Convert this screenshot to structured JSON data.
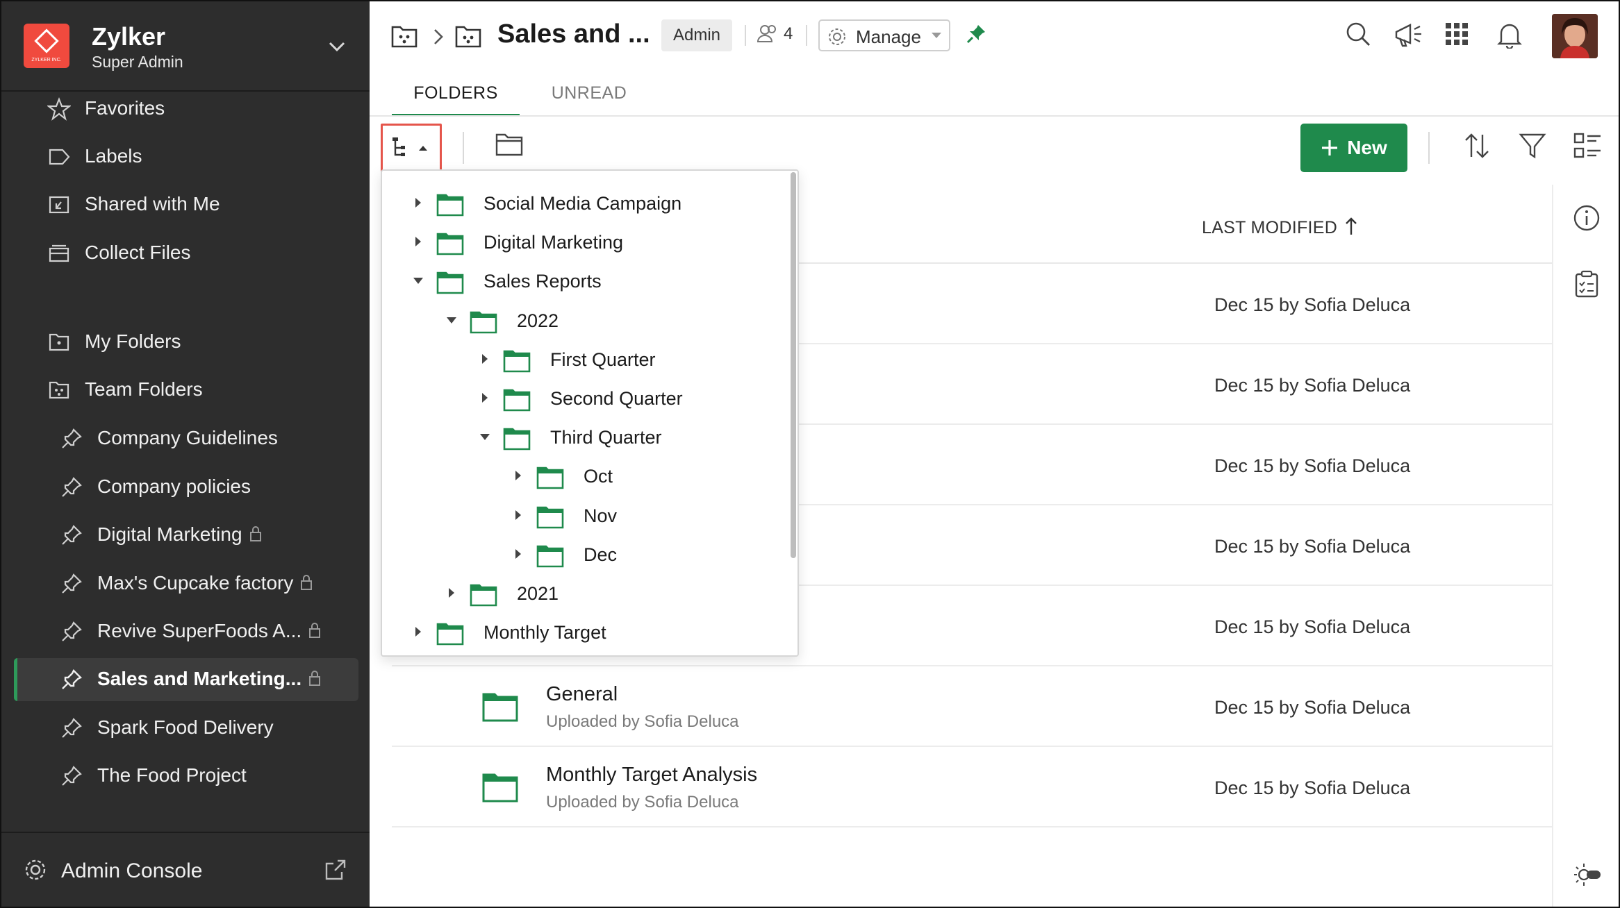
{
  "org": {
    "name": "Zylker",
    "role": "Super Admin",
    "logo_text": "ZYLKER INC."
  },
  "sidebar": {
    "top_items": [
      {
        "label": "Favorites",
        "icon": "star-icon"
      },
      {
        "label": "Labels",
        "icon": "label-icon"
      },
      {
        "label": "Shared with Me",
        "icon": "shared-icon"
      },
      {
        "label": "Collect Files",
        "icon": "collect-icon"
      }
    ],
    "folder_items": [
      {
        "label": "My Folders",
        "icon": "my-folders-icon"
      },
      {
        "label": "Team Folders",
        "icon": "team-folders-icon"
      }
    ],
    "team_folders": [
      {
        "label": "Company Guidelines",
        "locked": false,
        "active": false
      },
      {
        "label": "Company policies",
        "locked": false,
        "active": false
      },
      {
        "label": "Digital Marketing",
        "locked": true,
        "active": false
      },
      {
        "label": "Max's Cupcake factory",
        "locked": true,
        "active": false
      },
      {
        "label": "Revive SuperFoods A...",
        "locked": true,
        "active": false
      },
      {
        "label": "Sales and Marketing...",
        "locked": true,
        "active": true
      },
      {
        "label": "Spark Food Delivery",
        "locked": false,
        "active": false
      },
      {
        "label": "The Food Project",
        "locked": false,
        "active": false
      }
    ],
    "admin_console": "Admin Console"
  },
  "header": {
    "title": "Sales and ...",
    "badge": "Admin",
    "member_count": "4",
    "manage_label": "Manage"
  },
  "tabs": [
    {
      "label": "FOLDERS",
      "active": true
    },
    {
      "label": "UNREAD",
      "active": false
    }
  ],
  "toolbar": {
    "new_label": "New"
  },
  "list": {
    "column_header": "LAST MODIFIED",
    "rows": [
      {
        "name": "",
        "sub": "",
        "modified": "Dec 15 by Sofia Deluca"
      },
      {
        "name": "",
        "sub": "",
        "modified": "Dec 15 by Sofia Deluca"
      },
      {
        "name": "",
        "sub": "",
        "modified": "Dec 15 by Sofia Deluca"
      },
      {
        "name": "",
        "sub": "",
        "modified": "Dec 15 by Sofia Deluca"
      },
      {
        "name": "",
        "sub": "",
        "modified": "Dec 15 by Sofia Deluca"
      },
      {
        "name": "General",
        "sub": "Uploaded by Sofia Deluca",
        "modified": "Dec 15 by Sofia Deluca"
      },
      {
        "name": "Monthly Target Analysis",
        "sub": "Uploaded by Sofia Deluca",
        "modified": "Dec 15 by Sofia Deluca"
      }
    ]
  },
  "tree": [
    {
      "label": "Social Media Campaign",
      "depth": 0,
      "expanded": false
    },
    {
      "label": "Digital Marketing",
      "depth": 0,
      "expanded": false
    },
    {
      "label": "Sales Reports",
      "depth": 0,
      "expanded": true
    },
    {
      "label": "2022",
      "depth": 1,
      "expanded": true
    },
    {
      "label": "First Quarter",
      "depth": 2,
      "expanded": false
    },
    {
      "label": "Second Quarter",
      "depth": 2,
      "expanded": false
    },
    {
      "label": "Third Quarter",
      "depth": 2,
      "expanded": true
    },
    {
      "label": "Oct",
      "depth": 3,
      "expanded": false
    },
    {
      "label": "Nov",
      "depth": 3,
      "expanded": false
    },
    {
      "label": "Dec",
      "depth": 3,
      "expanded": false
    },
    {
      "label": "2021",
      "depth": 1,
      "expanded": false
    },
    {
      "label": "Monthly Target",
      "depth": 0,
      "expanded": false
    }
  ],
  "colors": {
    "accent": "#1f8a4c",
    "sidebar_bg": "#2d2d2d",
    "logo_bg": "#f04a3e",
    "highlight": "#e5554b"
  }
}
